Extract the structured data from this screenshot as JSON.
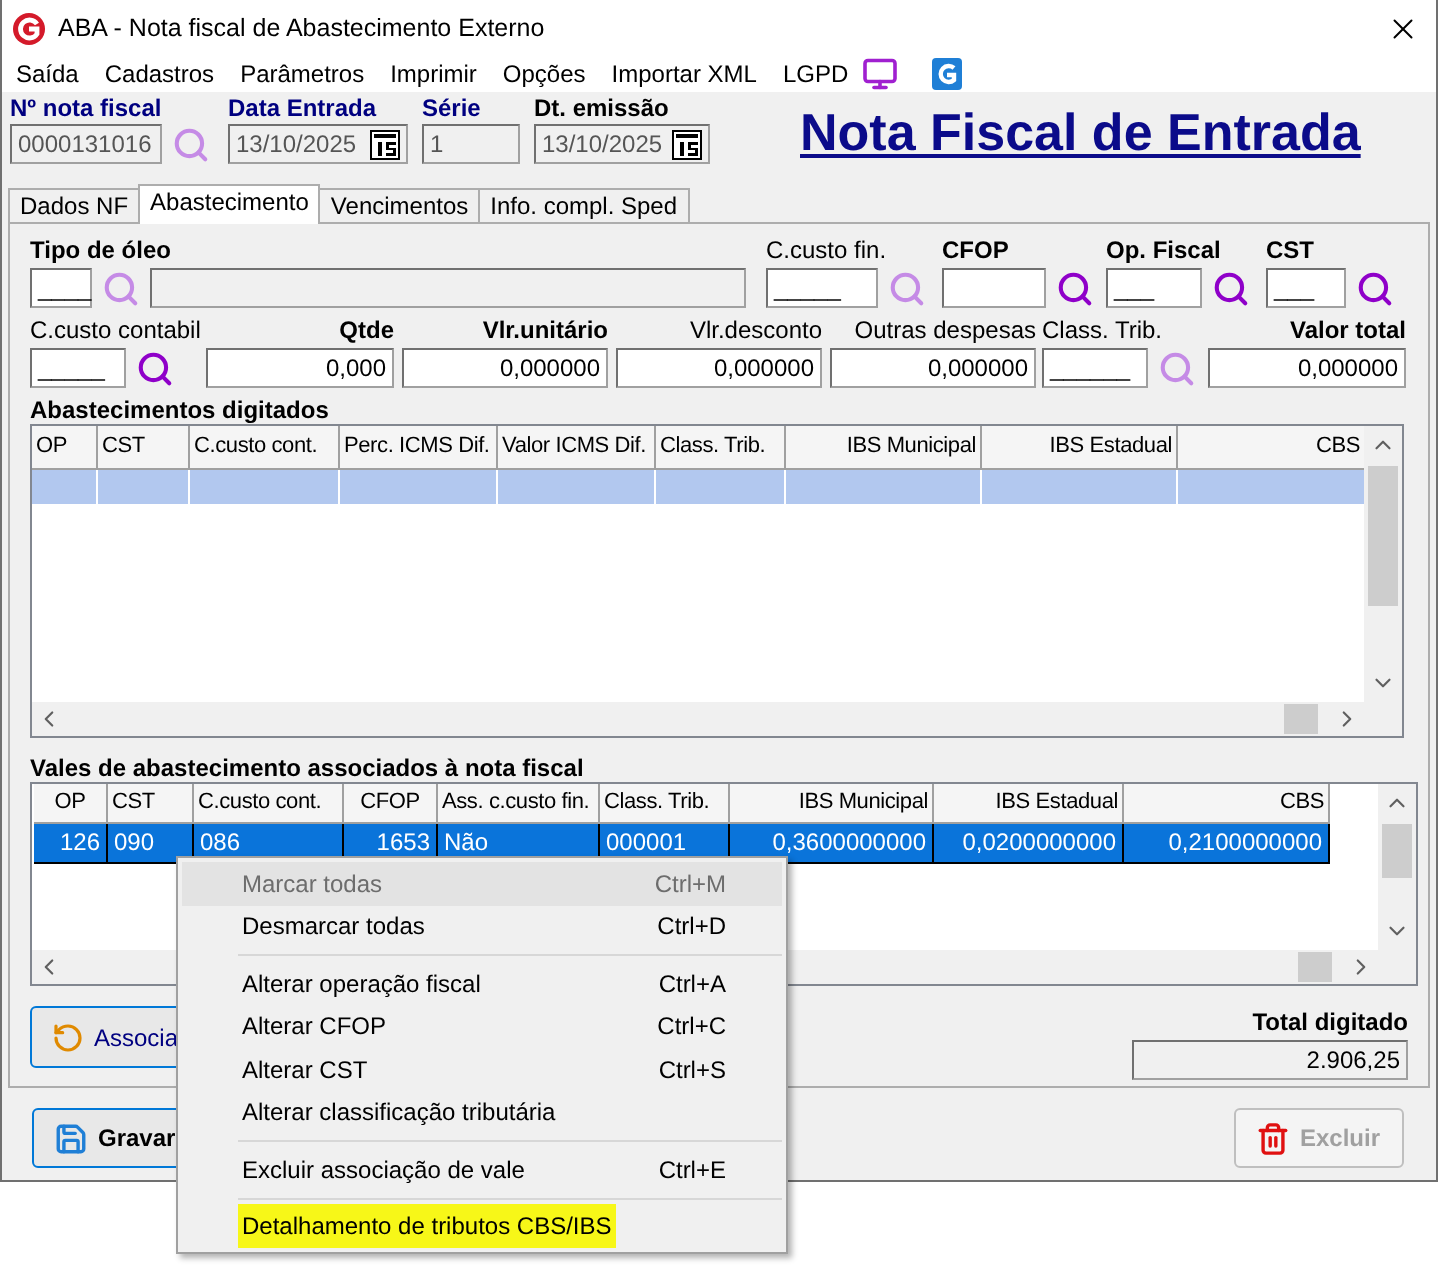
{
  "window": {
    "title": "ABA - Nota fiscal de Abastecimento Externo"
  },
  "menu": [
    "Saída",
    "Cadastros",
    "Parâmetros",
    "Imprimir",
    "Opções",
    "Importar XML",
    "LGPD"
  ],
  "header": {
    "fields": [
      {
        "label": "Nº nota fiscal",
        "value": "0000131016",
        "kind": "lookup",
        "required": true
      },
      {
        "label": "Data Entrada",
        "value": "13/10/2025",
        "kind": "date",
        "required": true
      },
      {
        "label": "Série",
        "value": "1",
        "kind": "text",
        "required": true
      },
      {
        "label": "Dt. emissão",
        "value": "13/10/2025",
        "kind": "date",
        "required": false
      }
    ],
    "title": "Nota Fiscal de Entrada"
  },
  "tabs": [
    {
      "label": "Dados NF",
      "selected": false
    },
    {
      "label": "Abastecimento",
      "selected": true
    },
    {
      "label": "Vencimentos",
      "selected": false
    },
    {
      "label": "Info. compl. Sped",
      "selected": false
    }
  ],
  "form_top": [
    {
      "label": "Tipo de óleo",
      "value": "____",
      "kind": "code",
      "required": true,
      "lookup_disabled": true,
      "has_description": true
    },
    {
      "label": "C.custo fin.",
      "value": "_____",
      "kind": "code",
      "required": false,
      "lookup_disabled": true
    },
    {
      "label": "CFOP",
      "kind": "code",
      "required": true,
      "lookup_disabled": false
    },
    {
      "label": "Op. Fiscal",
      "value": "___",
      "kind": "code",
      "required": true,
      "lookup_disabled": false
    },
    {
      "label": "CST",
      "value": "___",
      "kind": "code",
      "required": true,
      "lookup_disabled": false
    }
  ],
  "form_bottom": [
    {
      "label": "C.custo contabil",
      "value": "_____",
      "kind": "code",
      "required": false,
      "lookup_disabled": false
    },
    {
      "label": "Qtde",
      "value": "0,000",
      "kind": "number",
      "required": true
    },
    {
      "label": "Vlr.unitário",
      "value": "0,000000",
      "kind": "number",
      "required": true
    },
    {
      "label": "Vlr.desconto",
      "value": "0,000000",
      "kind": "number",
      "required": false
    },
    {
      "label": "Outras despesas",
      "value": "0,000000",
      "kind": "number",
      "required": false
    },
    {
      "label": "Class. Trib.",
      "value": "______",
      "kind": "code",
      "required": false,
      "lookup_disabled": true
    },
    {
      "label": "Valor total",
      "value": "0,000000",
      "kind": "number",
      "required": true
    }
  ],
  "grids": [
    {
      "title": "Abastecimentos digitados",
      "columns": [
        "OP",
        "CST",
        "C.custo cont.",
        "Perc. ICMS Dif.",
        "Valor ICMS Dif.",
        "Class. Trib.",
        "IBS Municipal",
        "IBS Estadual",
        "CBS"
      ],
      "rows": [
        {
          "selected": true
        }
      ]
    },
    {
      "title": "Vales de abastecimento associados à nota fiscal",
      "columns": [
        "OP",
        "CST",
        "C.custo cont.",
        "CFOP",
        "Ass. c.custo fin.",
        "Class. Trib.",
        "IBS Municipal",
        "IBS Estadual",
        "CBS"
      ],
      "rows": [
        {
          "selected": true,
          "cells": [
            "126",
            "090",
            "086",
            "1653",
            "Não",
            "000001",
            "0,3600000000",
            "0,0200000000",
            "0,2100000000"
          ]
        }
      ]
    }
  ],
  "associate_button": {
    "label": "Associa"
  },
  "total": {
    "label": "Total digitado",
    "value": "2.906,25"
  },
  "buttons": [
    {
      "label": "Gravar",
      "disabled": false
    },
    {
      "label": "Excluir",
      "disabled": true
    }
  ],
  "context_menu": [
    {
      "kind": "item",
      "label": "Marcar todas",
      "shortcut": "Ctrl+M",
      "disabled": true,
      "hovered": true,
      "marked": false
    },
    {
      "kind": "item",
      "label": "Desmarcar todas",
      "shortcut": "Ctrl+D",
      "disabled": false,
      "hovered": false,
      "marked": false
    },
    {
      "kind": "separator"
    },
    {
      "kind": "item",
      "label": "Alterar operação fiscal",
      "shortcut": "Ctrl+A",
      "disabled": false,
      "hovered": false,
      "marked": false
    },
    {
      "kind": "item",
      "label": "Alterar CFOP",
      "shortcut": "Ctrl+C",
      "disabled": false,
      "hovered": false,
      "marked": false
    },
    {
      "kind": "item",
      "label": "Alterar CST",
      "shortcut": "Ctrl+S",
      "disabled": false,
      "hovered": false,
      "marked": false
    },
    {
      "kind": "item",
      "label": "Alterar classificação tributária",
      "disabled": false,
      "hovered": false,
      "marked": false
    },
    {
      "kind": "separator"
    },
    {
      "kind": "item",
      "label": "Excluir associação de vale",
      "shortcut": "Ctrl+E",
      "disabled": false,
      "hovered": false,
      "marked": false
    },
    {
      "kind": "separator"
    },
    {
      "kind": "item",
      "label": "Detalhamento de tributos CBS/IBS",
      "disabled": false,
      "hovered": false,
      "marked": true
    }
  ]
}
